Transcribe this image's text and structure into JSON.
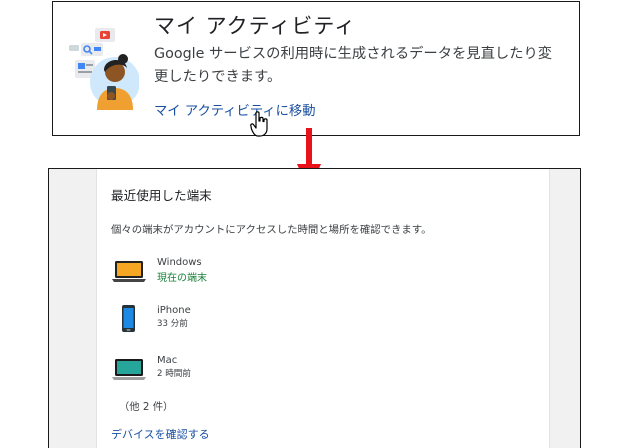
{
  "top_card": {
    "title": "マイ アクティビティ",
    "description": "Google サービスの利用時に生成されるデータを見直したり変更したりできます。",
    "link_label": "マイ アクティビティに移動"
  },
  "bottom_card": {
    "title": "最近使用した端末",
    "description": "個々の端末がアカウントにアクセスした時間と場所を確認できます。",
    "devices": [
      {
        "name": "Windows",
        "status": "現在の端末",
        "icon": "laptop-icon"
      },
      {
        "name": "iPhone",
        "status": "33 分前",
        "icon": "smartphone-icon"
      },
      {
        "name": "Mac",
        "status": "2 時間前",
        "icon": "macbook-icon"
      }
    ],
    "others_label": "（他 2 件）",
    "link_label": "デバイスを確認する"
  },
  "colors": {
    "link": "#1a4fa0",
    "current_device": "#188038",
    "arrow": "#e8121a"
  }
}
